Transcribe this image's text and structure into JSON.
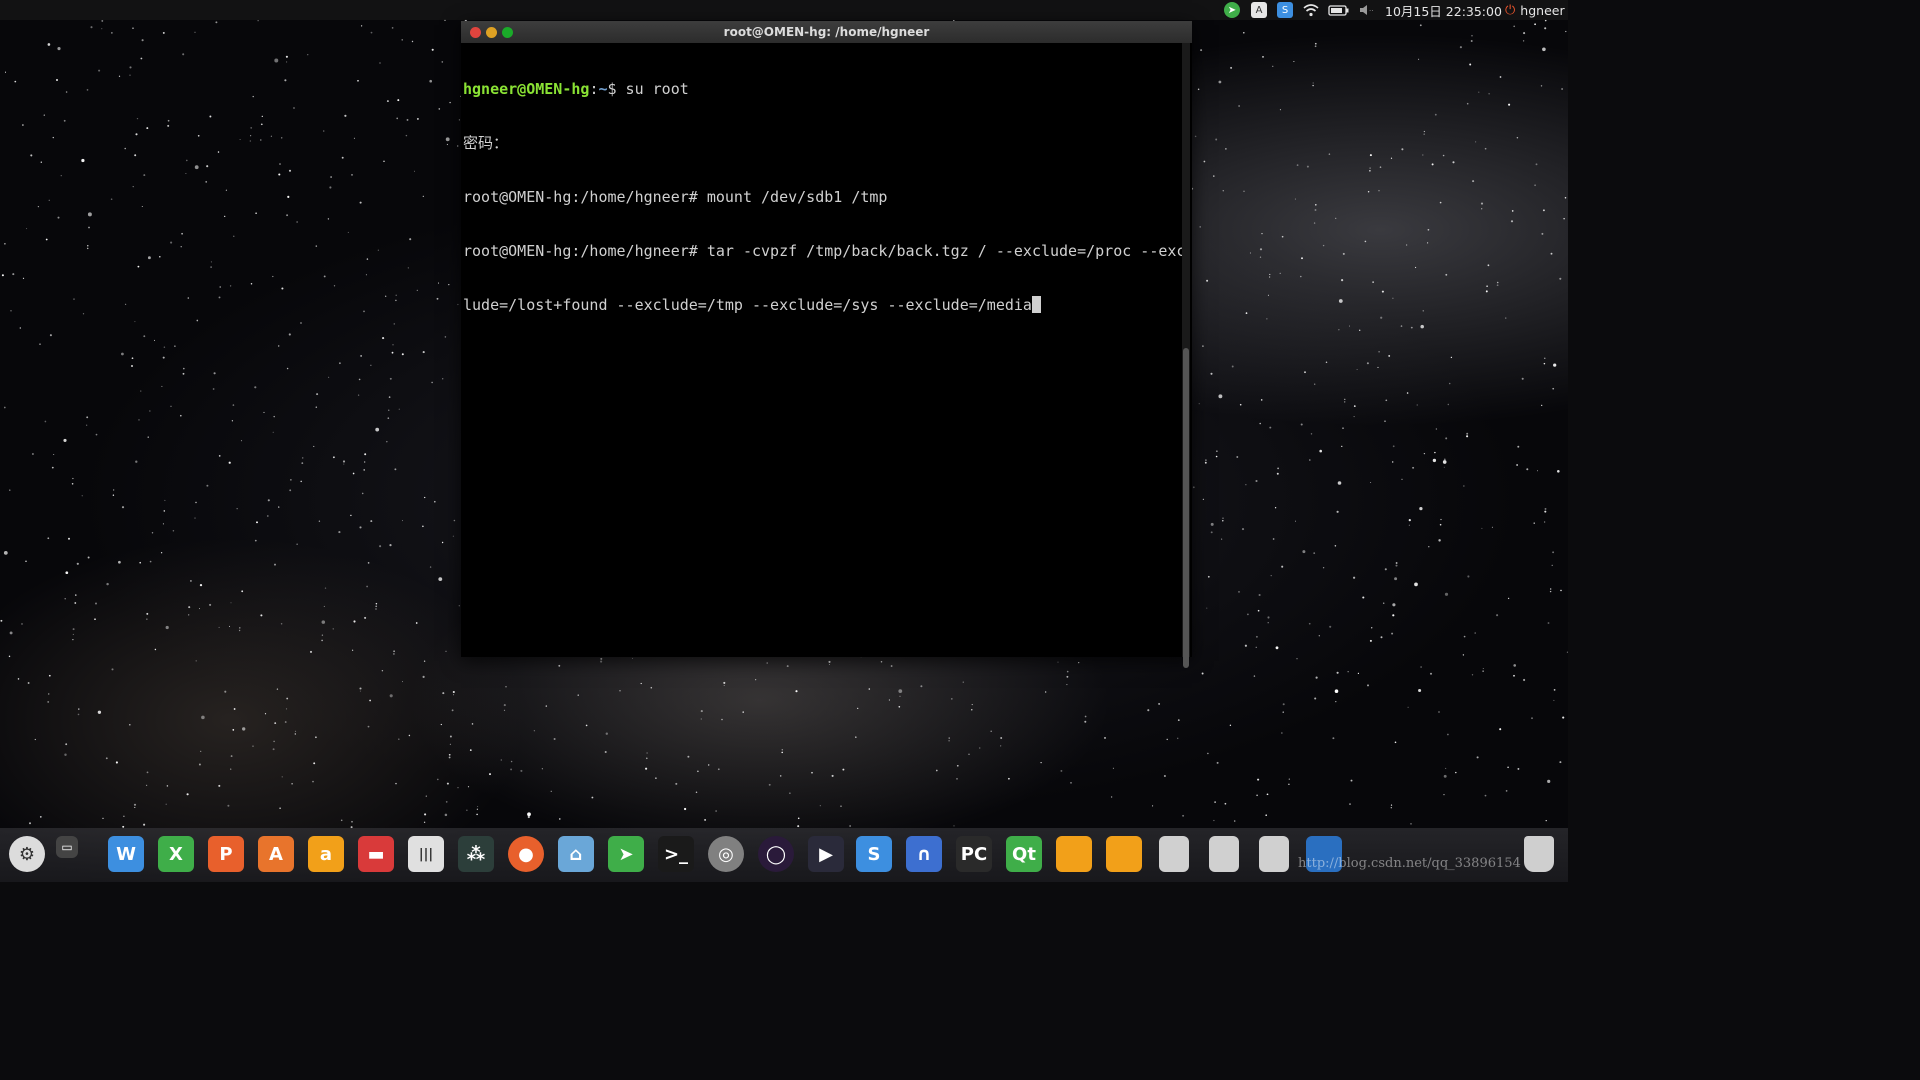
{
  "top_panel": {
    "datetime": "10月15日 22:35:00",
    "user": "hgneer",
    "tray_icons": [
      "telegram-icon",
      "keyboard-a-icon",
      "sogou-input-icon",
      "wifi-icon",
      "battery-icon",
      "volume-icon",
      "power-icon"
    ]
  },
  "terminal": {
    "title": "root@OMEN-hg: /home/hgneer",
    "lines": [
      {
        "user": "hgneer@OMEN-hg",
        "sep": ":",
        "path": "~",
        "rest": "$ su root"
      },
      {
        "text": "密码："
      },
      {
        "text": "root@OMEN-hg:/home/hgneer# mount /dev/sdb1 /tmp"
      },
      {
        "text": "root@OMEN-hg:/home/hgneer# tar -cvpzf /tmp/back/back.tgz / --exclude=/proc --exc"
      },
      {
        "text": "lude=/lost+found --exclude=/tmp --exclude=/sys --exclude=/media"
      }
    ]
  },
  "dock": {
    "items": [
      {
        "name": "launcher-icon",
        "color": "#dcdcdc",
        "glyph": "⚙"
      },
      {
        "name": "workspace-switcher-icon",
        "color": "#444444",
        "glyph": "▭"
      },
      {
        "name": "wps-writer-icon",
        "color": "#3d8fe0",
        "glyph": "W"
      },
      {
        "name": "wps-spreadsheet-icon",
        "color": "#3fae49",
        "glyph": "X"
      },
      {
        "name": "wps-presentation-icon",
        "color": "#e8602c",
        "glyph": "P"
      },
      {
        "name": "software-center-icon",
        "color": "#e8742c",
        "glyph": "A"
      },
      {
        "name": "amazon-icon",
        "color": "#f2a019",
        "glyph": "a"
      },
      {
        "name": "toolbox-icon",
        "color": "#d93a3a",
        "glyph": "▬"
      },
      {
        "name": "equalizer-icon",
        "color": "#e0e0e0",
        "glyph": "|||"
      },
      {
        "name": "network-icon",
        "color": "#2c3e3a",
        "glyph": "⁂"
      },
      {
        "name": "firefox-icon",
        "color": "#e8602c",
        "glyph": "●"
      },
      {
        "name": "files-icon",
        "color": "#6aa7d8",
        "glyph": "⌂"
      },
      {
        "name": "telegram-icon",
        "color": "#3fae49",
        "glyph": "➤"
      },
      {
        "name": "terminal-icon",
        "color": "#1a1a1a",
        "glyph": ">_"
      },
      {
        "name": "chrome-icon",
        "color": "#808080",
        "glyph": "◎"
      },
      {
        "name": "eclipse-icon",
        "color": "#2a1a3a",
        "glyph": "◯"
      },
      {
        "name": "media-player-icon",
        "color": "#2a2a3a",
        "glyph": "▶"
      },
      {
        "name": "sogou-icon",
        "color": "#3d8fe0",
        "glyph": "S"
      },
      {
        "name": "wireshark-icon",
        "color": "#3d6fd0",
        "glyph": "∩"
      },
      {
        "name": "pycharm-icon",
        "color": "#2a2a2a",
        "glyph": "PC"
      },
      {
        "name": "qt-creator-icon",
        "color": "#3fae49",
        "glyph": "Qt"
      },
      {
        "name": "orange-app-icon-1",
        "color": "#f2a019",
        "glyph": ""
      },
      {
        "name": "orange-app-icon-2",
        "color": "#f2a019",
        "glyph": ""
      },
      {
        "name": "drive-icon-1",
        "color": "#d0d0d0",
        "glyph": ""
      },
      {
        "name": "drive-icon-2",
        "color": "#d0d0d0",
        "glyph": ""
      },
      {
        "name": "drive-icon-3",
        "color": "#d0d0d0",
        "glyph": ""
      },
      {
        "name": "remote-desktop-icon",
        "color": "#2a6fc0",
        "glyph": ""
      },
      {
        "name": "trash-icon",
        "color": "#cfcfcf",
        "glyph": ""
      }
    ]
  },
  "watermark": "http://blog.csdn.net/qq_33896154"
}
